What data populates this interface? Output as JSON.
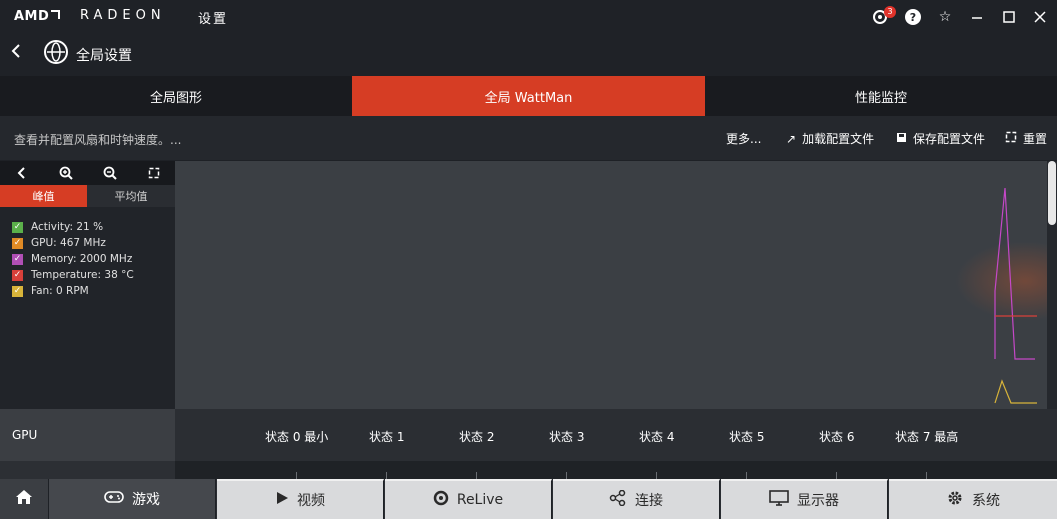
{
  "window": {
    "logo": "AMD",
    "brand": "RADEON",
    "app_name": "设置",
    "notification_count": "3",
    "controls": [
      "help-icon",
      "star-icon",
      "minimize-icon",
      "maximize-icon",
      "close-icon"
    ]
  },
  "header": {
    "title": "全局设置",
    "back_icon": "back-arrow-icon",
    "globe_icon": "globe-icon"
  },
  "tabs": [
    {
      "label": "全局图形",
      "active": false
    },
    {
      "label": "全局 WattMan",
      "active": true
    },
    {
      "label": "性能监控",
      "active": false
    }
  ],
  "actionbar": {
    "description": "查看并配置风扇和时钟速度。...",
    "more": "更多...",
    "load_profile": "加载配置文件",
    "save_profile": "保存配置文件",
    "reset": "重置"
  },
  "graph_panel": {
    "segment_peak": "峰值",
    "segment_avg": "平均值",
    "legend": [
      {
        "label": "Activity: 21 %",
        "color": "#5bb04a"
      },
      {
        "label": "GPU: 467 MHz",
        "color": "#e08a25"
      },
      {
        "label": "Memory: 2000 MHz",
        "color": "#b14fb5"
      },
      {
        "label": "Temperature: 38 °C",
        "color": "#d8403a"
      },
      {
        "label": "Fan: 0 RPM",
        "color": "#d8b43a"
      }
    ]
  },
  "gpu_row": {
    "label": "GPU",
    "states": [
      "状态 0 最小",
      "状态 1",
      "状态 2",
      "状态 3",
      "状态 4",
      "状态 5",
      "状态 6",
      "状态 7 最高"
    ]
  },
  "bottom_nav": [
    {
      "label": "",
      "icon": "home-icon"
    },
    {
      "label": "游戏",
      "icon": "gamepad-icon"
    },
    {
      "label": "视频",
      "icon": "play-icon"
    },
    {
      "label": "ReLive",
      "icon": "relive-icon"
    },
    {
      "label": "连接",
      "icon": "share-icon"
    },
    {
      "label": "显示器",
      "icon": "monitor-icon"
    },
    {
      "label": "系统",
      "icon": "gear-icon"
    }
  ],
  "colors": {
    "accent": "#d63d24",
    "background": "#1e2126"
  }
}
